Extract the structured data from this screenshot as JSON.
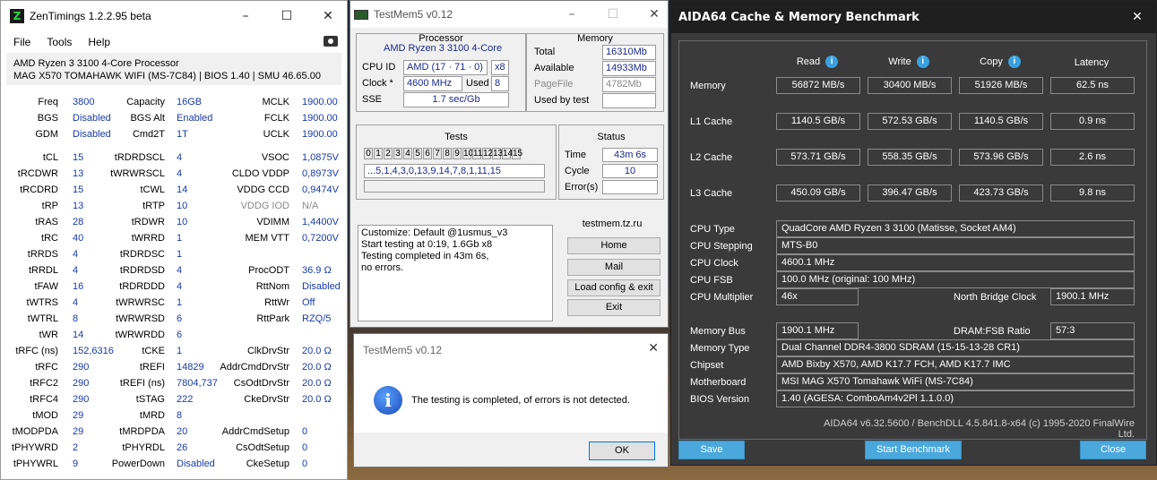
{
  "zentimings": {
    "title": "ZenTimings 1.2.2.95 beta",
    "menu": [
      "File",
      "Tools",
      "Help"
    ],
    "cpu": "AMD Ryzen 3 3100 4-Core Processor",
    "board": "MAG X570 TOMAHAWK WIFI (MS-7C84) | BIOS 1.40 | SMU 46.65.00",
    "rows": [
      [
        [
          "Freq",
          "3800"
        ],
        [
          "Capacity",
          "16GB"
        ],
        [
          "MCLK",
          "1900.00"
        ]
      ],
      [
        [
          "BGS",
          "Disabled"
        ],
        [
          "BGS Alt",
          "Enabled"
        ],
        [
          "FCLK",
          "1900.00"
        ]
      ],
      [
        [
          "GDM",
          "Disabled"
        ],
        [
          "Cmd2T",
          "1T"
        ],
        [
          "UCLK",
          "1900.00"
        ]
      ],
      null,
      [
        [
          "tCL",
          "15"
        ],
        [
          "tRDRDSCL",
          "4"
        ],
        [
          "VSOC",
          "1,0875V"
        ]
      ],
      [
        [
          "tRCDWR",
          "13"
        ],
        [
          "tWRWRSCL",
          "4"
        ],
        [
          "CLDO VDDP",
          "0,8973V"
        ]
      ],
      [
        [
          "tRCDRD",
          "15"
        ],
        [
          "tCWL",
          "14"
        ],
        [
          "VDDG CCD",
          "0,9474V"
        ]
      ],
      [
        [
          "tRP",
          "13"
        ],
        [
          "tRTP",
          "10"
        ],
        [
          "VDDG IOD",
          "N/A"
        ]
      ],
      [
        [
          "tRAS",
          "28"
        ],
        [
          "tRDWR",
          "10"
        ],
        [
          "VDIMM",
          "1,4400V"
        ]
      ],
      [
        [
          "tRC",
          "40"
        ],
        [
          "tWRRD",
          "1"
        ],
        [
          "MEM VTT",
          "0,7200V"
        ]
      ],
      [
        [
          "tRRDS",
          "4"
        ],
        [
          "tRDRDSC",
          "1"
        ],
        [
          "",
          ""
        ]
      ],
      [
        [
          "tRRDL",
          "4"
        ],
        [
          "tRDRDSD",
          "4"
        ],
        [
          "ProcODT",
          "36.9 Ω"
        ]
      ],
      [
        [
          "tFAW",
          "16"
        ],
        [
          "tRDRDDD",
          "4"
        ],
        [
          "RttNom",
          "Disabled"
        ]
      ],
      [
        [
          "tWTRS",
          "4"
        ],
        [
          "tWRWRSC",
          "1"
        ],
        [
          "RttWr",
          "Off"
        ]
      ],
      [
        [
          "tWTRL",
          "8"
        ],
        [
          "tWRWRSD",
          "6"
        ],
        [
          "RttPark",
          "RZQ/5"
        ]
      ],
      [
        [
          "tWR",
          "14"
        ],
        [
          "tWRWRDD",
          "6"
        ],
        [
          "",
          ""
        ]
      ],
      [
        [
          "tRFC (ns)",
          "152,6316"
        ],
        [
          "tCKE",
          "1"
        ],
        [
          "ClkDrvStr",
          "20.0 Ω"
        ]
      ],
      [
        [
          "tRFC",
          "290"
        ],
        [
          "tREFI",
          "14829"
        ],
        [
          "AddrCmdDrvStr",
          "20.0 Ω"
        ]
      ],
      [
        [
          "tRFC2",
          "290"
        ],
        [
          "tREFI (ns)",
          "7804,737"
        ],
        [
          "CsOdtDrvStr",
          "20.0 Ω"
        ]
      ],
      [
        [
          "tRFC4",
          "290"
        ],
        [
          "tSTAG",
          "222"
        ],
        [
          "CkeDrvStr",
          "20.0 Ω"
        ]
      ],
      [
        [
          "tMOD",
          "29"
        ],
        [
          "tMRD",
          "8"
        ],
        [
          "",
          ""
        ]
      ],
      [
        [
          "tMODPDA",
          "29"
        ],
        [
          "tMRDPDA",
          "20"
        ],
        [
          "AddrCmdSetup",
          "0"
        ]
      ],
      [
        [
          "tPHYWRD",
          "2"
        ],
        [
          "tPHYRDL",
          "26"
        ],
        [
          "CsOdtSetup",
          "0"
        ]
      ],
      [
        [
          "tPHYWRL",
          "9"
        ],
        [
          "PowerDown",
          "Disabled"
        ],
        [
          "CkeSetup",
          "0"
        ]
      ]
    ]
  },
  "testmem": {
    "title": "TestMem5 v0.12",
    "processor_label": "Processor",
    "cpu_name": "AMD Ryzen 3 3100 4-Core",
    "cpuid_label": "CPU ID",
    "cpuid": "AMD  (17 · 71 · 0)",
    "cpuid_x": "x8",
    "clock_label": "Clock *",
    "clock": "4600 MHz",
    "used_label": "Used",
    "used": "8",
    "sse_label": "SSE",
    "sse": "1.7 sec/Gb",
    "memory_label": "Memory",
    "total_label": "Total",
    "total": "16310Mb",
    "available_label": "Available",
    "available": "14933Mb",
    "pagefile_label": "PageFile",
    "pagefile": "4782Mb",
    "usedby_label": "Used by test",
    "tests_label": "Tests",
    "tests": [
      "0",
      "1",
      "2",
      "3",
      "4",
      "5",
      "6",
      "7",
      "8",
      "9",
      "10",
      "11",
      "12",
      "13",
      "14",
      "15"
    ],
    "sequence": "...5,1,4,3,0,13,9,14,7,8,1,11,15",
    "status_label": "Status",
    "time_label": "Time",
    "time": "43m 6s",
    "cycle_label": "Cycle",
    "cycle": "10",
    "errors_label": "Error(s)",
    "log": [
      "Customize: Default @1usmus_v3",
      "Start testing at 0:19, 1.6Gb x8",
      "Testing completed in 43m 6s,",
      "no errors."
    ],
    "site": "testmem.tz.ru",
    "buttons": [
      "Home",
      "Mail",
      "Load config & exit",
      "Exit"
    ]
  },
  "dialog": {
    "title": "TestMem5 v0.12",
    "message": "The testing is completed, of errors is not detected.",
    "ok": "OK"
  },
  "aida": {
    "title": "AIDA64 Cache & Memory Benchmark",
    "headers": [
      "Read",
      "Write",
      "Copy",
      "Latency"
    ],
    "bench": [
      {
        "label": "Memory",
        "vals": [
          "56872 MB/s",
          "30400 MB/s",
          "51926 MB/s",
          "62.5 ns"
        ]
      },
      {
        "label": "L1 Cache",
        "vals": [
          "1140.5 GB/s",
          "572.53 GB/s",
          "1140.5 GB/s",
          "0.9 ns"
        ]
      },
      {
        "label": "L2 Cache",
        "vals": [
          "573.71 GB/s",
          "558.35 GB/s",
          "573.96 GB/s",
          "2.6 ns"
        ]
      },
      {
        "label": "L3 Cache",
        "vals": [
          "450.09 GB/s",
          "396.47 GB/s",
          "423.73 GB/s",
          "9.8 ns"
        ]
      }
    ],
    "cpu_type_label": "CPU Type",
    "cpu_type": "QuadCore AMD Ryzen 3 3100  (Matisse, Socket AM4)",
    "cpu_stepping_label": "CPU Stepping",
    "cpu_stepping": "MTS-B0",
    "cpu_clock_label": "CPU Clock",
    "cpu_clock": "4600.1 MHz",
    "cpu_fsb_label": "CPU FSB",
    "cpu_fsb": "100.0 MHz  (original: 100 MHz)",
    "cpu_mult_label": "CPU Multiplier",
    "cpu_mult": "46x",
    "nb_label": "North Bridge Clock",
    "nb": "1900.1 MHz",
    "membus_label": "Memory Bus",
    "membus": "1900.1 MHz",
    "dram_label": "DRAM:FSB Ratio",
    "dram": "57:3",
    "memtype_label": "Memory Type",
    "memtype": "Dual Channel DDR4-3800 SDRAM  (15-15-13-28 CR1)",
    "chipset_label": "Chipset",
    "chipset": "AMD Bixby X570, AMD K17.7 FCH, AMD K17.7 IMC",
    "mobo_label": "Motherboard",
    "mobo": "MSI MAG X570 Tomahawk WiFi (MS-7C84)",
    "bios_label": "BIOS Version",
    "bios": "1.40  (AGESA: ComboAm4v2Pl 1.1.0.0)",
    "footer": "AIDA64 v6.32.5600 / BenchDLL 4.5.841.8-x64  (c) 1995-2020 FinalWire Ltd.",
    "save": "Save",
    "start": "Start Benchmark",
    "close": "Close"
  }
}
